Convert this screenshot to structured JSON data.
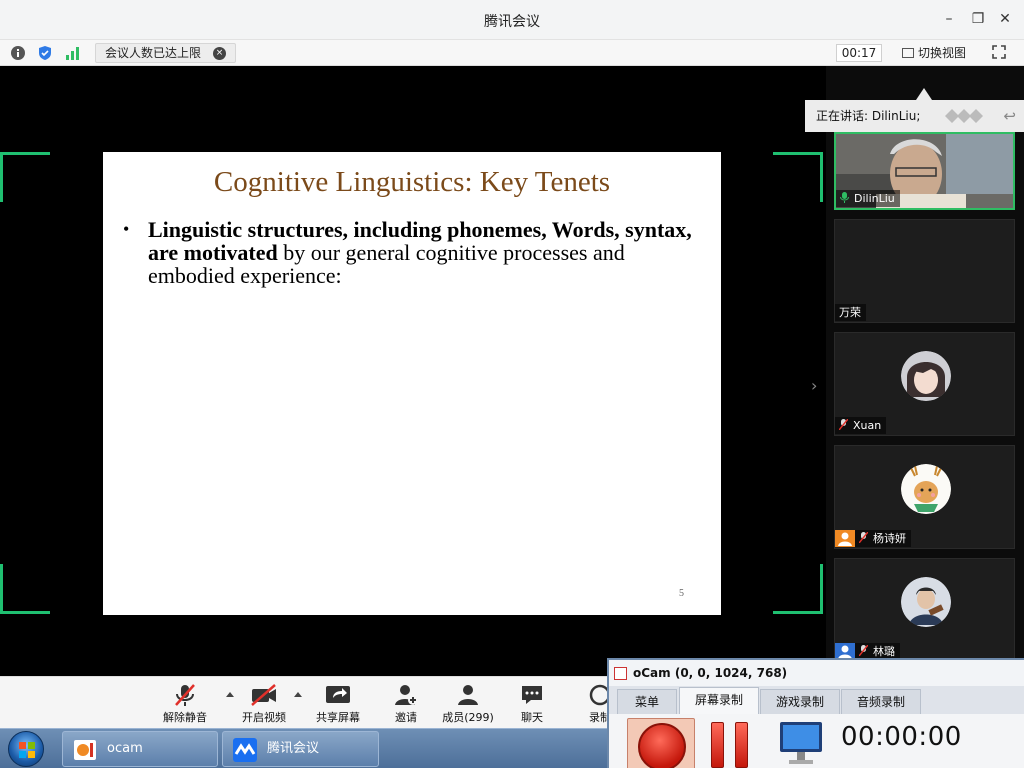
{
  "app": {
    "title": "腾讯会议"
  },
  "window_controls": {
    "minimize": "–",
    "restore": "❐",
    "close": "✕"
  },
  "infobar": {
    "limit_notice": "会议人数已达上限",
    "close_glyph": "×",
    "timer": "00:17",
    "switch_view_label": "切换视图"
  },
  "slide": {
    "title": "Cognitive Linguistics: Key Tenets",
    "bullet_glyph": "•",
    "bullet_bold": "Linguistic structures, including phonemes, Words, syntax, are motivated",
    "bullet_rest": " by our general cognitive processes and embodied experience:",
    "page_number": "5"
  },
  "side_panel_arrow": "›",
  "speaking": {
    "label": "正在讲话: DilinLiu;",
    "back_glyph": "↩"
  },
  "participants": [
    {
      "name": "DilinLiu",
      "muted": false,
      "active": true
    },
    {
      "name": "万荣",
      "muted": null,
      "active": false
    },
    {
      "name": "Xuan",
      "muted": true,
      "active": false
    },
    {
      "name": "杨诗妍",
      "muted": true,
      "active": false
    },
    {
      "name": "林璐",
      "muted": true,
      "active": false
    }
  ],
  "toolbar": {
    "unmute": "解除静音",
    "start_video": "开启视频",
    "share_screen": "共享屏幕",
    "invite": "邀请",
    "members": "成员(299)",
    "chat": "聊天",
    "record": "录制"
  },
  "taskbar": {
    "items": [
      {
        "label": "ocam"
      },
      {
        "label": "腾讯会议"
      }
    ]
  },
  "ocam": {
    "title": "oCam (0, 0, 1024, 768)",
    "tabs": [
      "菜单",
      "屏幕录制",
      "游戏录制",
      "音频录制"
    ],
    "selected_tab": "屏幕录制",
    "elapsed": "00:00:00"
  },
  "colors": {
    "accent_green": "#1fc071",
    "slide_title": "#7b4a1a",
    "record_red": "#c4170b"
  }
}
